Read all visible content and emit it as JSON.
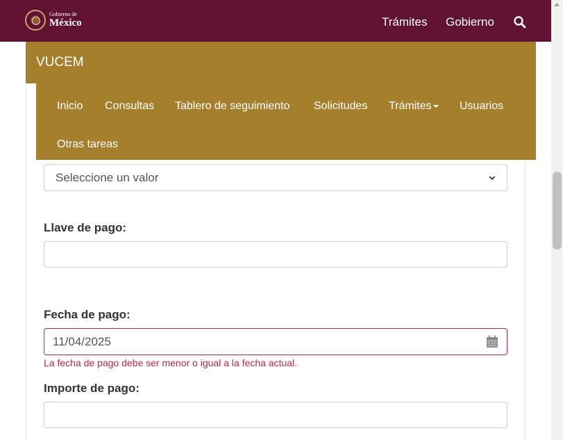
{
  "gov_header": {
    "logo_small": "Gobierno de",
    "logo_big": "México",
    "nav": [
      "Trámites",
      "Gobierno"
    ],
    "bg_color": "#611232",
    "search_icon": "search-icon"
  },
  "vucem": {
    "title": "VUCEM",
    "bg_color": "#a57f2c",
    "menu": [
      {
        "label": "Inicio"
      },
      {
        "label": "Consultas"
      },
      {
        "label": "Tablero de seguimiento"
      },
      {
        "label": "Solicitudes"
      },
      {
        "label": "Trámites",
        "has_dropdown": true
      },
      {
        "label": "Usuarios"
      },
      {
        "label": "Otras tareas"
      }
    ]
  },
  "form": {
    "select_value": "Seleccione un valor",
    "llave_label": "Llave de pago:",
    "llave_value": "",
    "fecha_label": "Fecha de pago:",
    "fecha_value": "11/04/2025",
    "fecha_error": "La fecha de pago debe ser menor o igual a la fecha actual.",
    "importe_label": "Importe de pago:",
    "importe_value": "",
    "error_color": "#c0264a"
  }
}
